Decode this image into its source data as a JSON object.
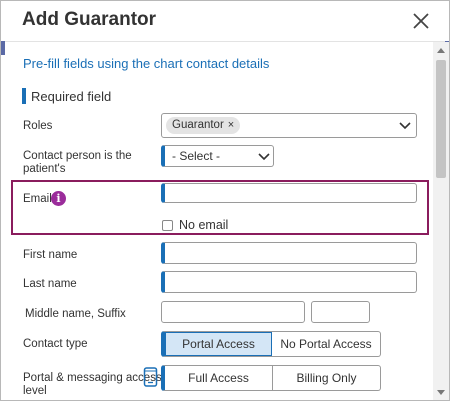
{
  "dialog": {
    "title": "Add Guarantor",
    "close_icon": "close-icon"
  },
  "prefill_link": "Pre-fill fields using the chart contact details",
  "required_field": "Required field",
  "roles": {
    "label": "Roles",
    "chip": "Guarantor",
    "chip_remove": "×"
  },
  "contact_person": {
    "label_line1": "Contact person is the",
    "label_line2": "patient's",
    "value": "- Select -"
  },
  "email": {
    "label": "Email",
    "info_icon_glyph": "i",
    "value": "",
    "no_email_label": "No email",
    "highlight_color": "#8a1c5d"
  },
  "first_name": {
    "label": "First name",
    "value": ""
  },
  "last_name": {
    "label": "Last name",
    "value": ""
  },
  "middle_suffix": {
    "label": "Middle name, Suffix",
    "middle_value": "",
    "suffix_value": ""
  },
  "contact_type": {
    "label": "Contact type",
    "options": [
      "Portal Access",
      "No Portal Access"
    ],
    "selected": "Portal Access"
  },
  "portal_access": {
    "label_line1": "Portal & messaging access",
    "label_line2": "level",
    "options": [
      "Full Access",
      "Billing Only"
    ]
  },
  "colors": {
    "accent": "#1a6fb6",
    "selected_bg": "#d4e6f6",
    "info_icon": "#9b2c9b"
  }
}
